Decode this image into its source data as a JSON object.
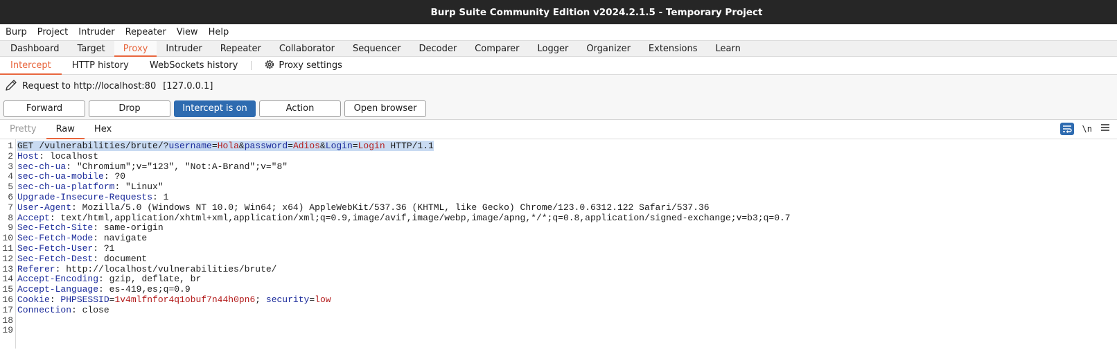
{
  "window": {
    "title": "Burp Suite Community Edition v2024.2.1.5 - Temporary Project"
  },
  "menu": [
    "Burp",
    "Project",
    "Intruder",
    "Repeater",
    "View",
    "Help"
  ],
  "tabs": [
    "Dashboard",
    "Target",
    "Proxy",
    "Intruder",
    "Repeater",
    "Collaborator",
    "Sequencer",
    "Decoder",
    "Comparer",
    "Logger",
    "Organizer",
    "Extensions",
    "Learn"
  ],
  "subtabs": {
    "intercept": "Intercept",
    "http_history": "HTTP history",
    "websockets": "WebSockets history",
    "settings": "Proxy settings"
  },
  "request": {
    "label": "Request to http://localhost:80",
    "ip": "[127.0.0.1]"
  },
  "actions": {
    "forward": "Forward",
    "drop": "Drop",
    "intercept": "Intercept is on",
    "action": "Action",
    "open_browser": "Open browser"
  },
  "editor": {
    "tabs": {
      "pretty": "Pretty",
      "raw": "Raw",
      "hex": "Hex"
    },
    "newline_label": "\\n",
    "line1": {
      "method": "GET",
      "path": " /vulnerabilities/brute/?",
      "p1": "username",
      "v1": "Hola",
      "p2": "password",
      "v2": "Adios",
      "p3": "Login",
      "v3": "Login",
      "version": " HTTP/1.1"
    },
    "headers": [
      {
        "name": "Host",
        "value": "localhost"
      },
      {
        "name": "sec-ch-ua",
        "value": "\"Chromium\";v=\"123\", \"Not:A-Brand\";v=\"8\""
      },
      {
        "name": "sec-ch-ua-mobile",
        "value": "?0"
      },
      {
        "name": "sec-ch-ua-platform",
        "value": "\"Linux\""
      },
      {
        "name": "Upgrade-Insecure-Requests",
        "value": "1"
      },
      {
        "name": "User-Agent",
        "value": "Mozilla/5.0 (Windows NT 10.0; Win64; x64) AppleWebKit/537.36 (KHTML, like Gecko) Chrome/123.0.6312.122 Safari/537.36"
      },
      {
        "name": "Accept",
        "value": "text/html,application/xhtml+xml,application/xml;q=0.9,image/avif,image/webp,image/apng,*/*;q=0.8,application/signed-exchange;v=b3;q=0.7"
      },
      {
        "name": "Sec-Fetch-Site",
        "value": "same-origin"
      },
      {
        "name": "Sec-Fetch-Mode",
        "value": "navigate"
      },
      {
        "name": "Sec-Fetch-User",
        "value": "?1"
      },
      {
        "name": "Sec-Fetch-Dest",
        "value": "document"
      },
      {
        "name": "Referer",
        "value": "http://localhost/vulnerabilities/brute/"
      },
      {
        "name": "Accept-Encoding",
        "value": "gzip, deflate, br"
      },
      {
        "name": "Accept-Language",
        "value": "es-419,es;q=0.9"
      }
    ],
    "cookie": {
      "name": "Cookie",
      "c1": "PHPSESSID",
      "v1": "1v4mlfnfor4q1obuf7n44h0pn6",
      "c2": "security",
      "v2": "low"
    },
    "connection": {
      "name": "Connection",
      "value": "close"
    },
    "line_numbers": [
      "1",
      "2",
      "3",
      "4",
      "5",
      "6",
      "7",
      "8",
      "9",
      "10",
      "11",
      "12",
      "13",
      "14",
      "15",
      "16",
      "17",
      "18",
      "19"
    ]
  }
}
